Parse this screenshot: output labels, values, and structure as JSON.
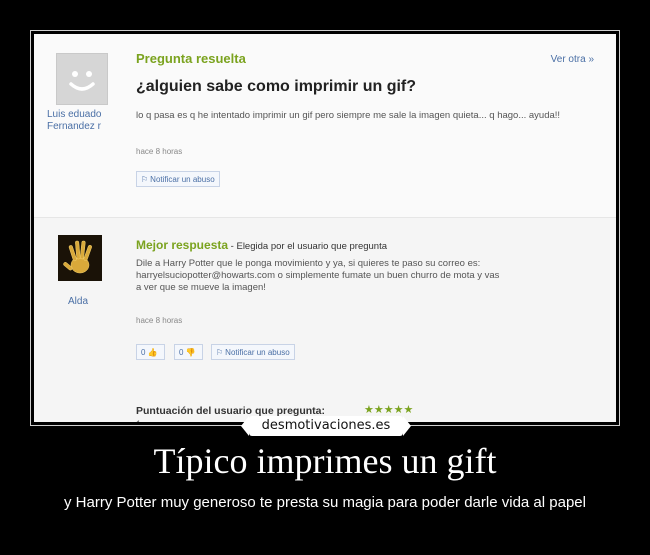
{
  "question": {
    "status_label": "Pregunta resuelta",
    "other_link": "Ver otra »",
    "title": "¿alguien sabe como imprimir un gif?",
    "user_line1": "Luis eduado",
    "user_line2": "Fernandez r",
    "body": "lo q pasa es q he intentado imprimir un gif pero siempre me sale la imagen quieta... q hago... ayuda!!",
    "time": "hace 8 horas",
    "report_label": "Notificar un abuso"
  },
  "answer": {
    "label": "Mejor respuesta",
    "chosen": " - Elegida por el usuario que pregunta",
    "user": "Alda",
    "body_line1": "Dile a Harry Potter que le ponga movimiento y ya, si quieres te paso su correo es:",
    "body_line2": "harryelsuciopotter@howarts.com o simplemente fumate un buen churro de mota y vas",
    "body_line3": "a ver que se mueve la imagen!",
    "time": "hace 8 horas",
    "thumbs_up_count": "0",
    "thumbs_down_count": "0",
    "report_label": "Notificar un abuso",
    "rating_label": "Puntuación del usuario que pregunta:",
    "stars": "★★★★★",
    "tick": "1"
  },
  "poster": {
    "site": "desmotivaciones.es",
    "headline": "Típico imprimes un gift",
    "caption": "y Harry Potter muy generoso te presta su magia para poder darle vida al papel"
  },
  "colors": {
    "accent_green": "#7ba31f",
    "link_blue": "#4a6fa5",
    "background": "#000000"
  }
}
